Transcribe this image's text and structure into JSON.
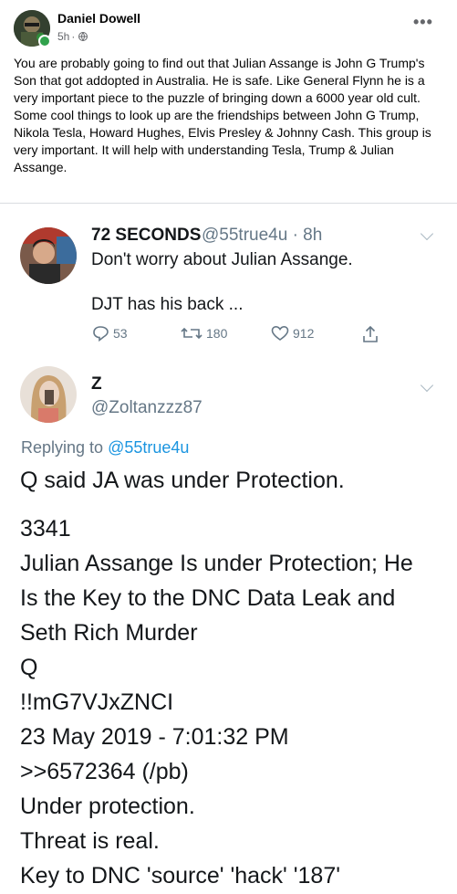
{
  "post": {
    "author": "Daniel Dowell",
    "time": "5h",
    "dot": "·",
    "more": "•••",
    "paragraphs": [
      "You are probably going to find out that Julian Assange is John G Trump's Son that got addopted in Australia. He is safe. Like General Flynn he is a very important piece to the puzzle of bringing down a 6000 year old cult.",
      "Some cool things to look up are the friendships between John G Trump, Nikola Tesla, Howard Hughes, Elvis Presley & Johnny Cash. This group is very important. It will help with understanding Tesla, Trump & Julian Assange."
    ]
  },
  "tweet1": {
    "name": "72 SECONDS",
    "handle": "@55true4u · 8h",
    "line1": "Don't worry about Julian Assange.",
    "line2": "DJT has his back ...",
    "replies": "53",
    "retweets": "180",
    "likes": "912"
  },
  "tweet2": {
    "name": "Z",
    "handle": "@Zoltanzzz87",
    "replying_prefix": "Replying to ",
    "replying_handle": "@55true4u",
    "lines": [
      "Q said JA was under Protection.",
      "3341",
      "Julian Assange Is under Protection; He",
      "Is the Key to the DNC Data Leak and",
      "Seth Rich Murder",
      "Q",
      "!!mG7VJxZNCI",
      "23 May 2019 - 7:01:32 PM",
      ">>6572364 (/pb)",
      "Under protection.",
      "Threat is real.",
      "Key to DNC 'source' 'hack' '187'"
    ]
  },
  "colors": {
    "fb_text": "#050505",
    "fb_meta": "#65676b",
    "online": "#31a24c",
    "tw_link": "#1b95e0",
    "tw_gray": "#657786"
  },
  "icons": [
    "globe-icon",
    "more-icon",
    "reply-icon",
    "retweet-icon",
    "like-icon",
    "share-icon",
    "chevron-down-icon"
  ]
}
